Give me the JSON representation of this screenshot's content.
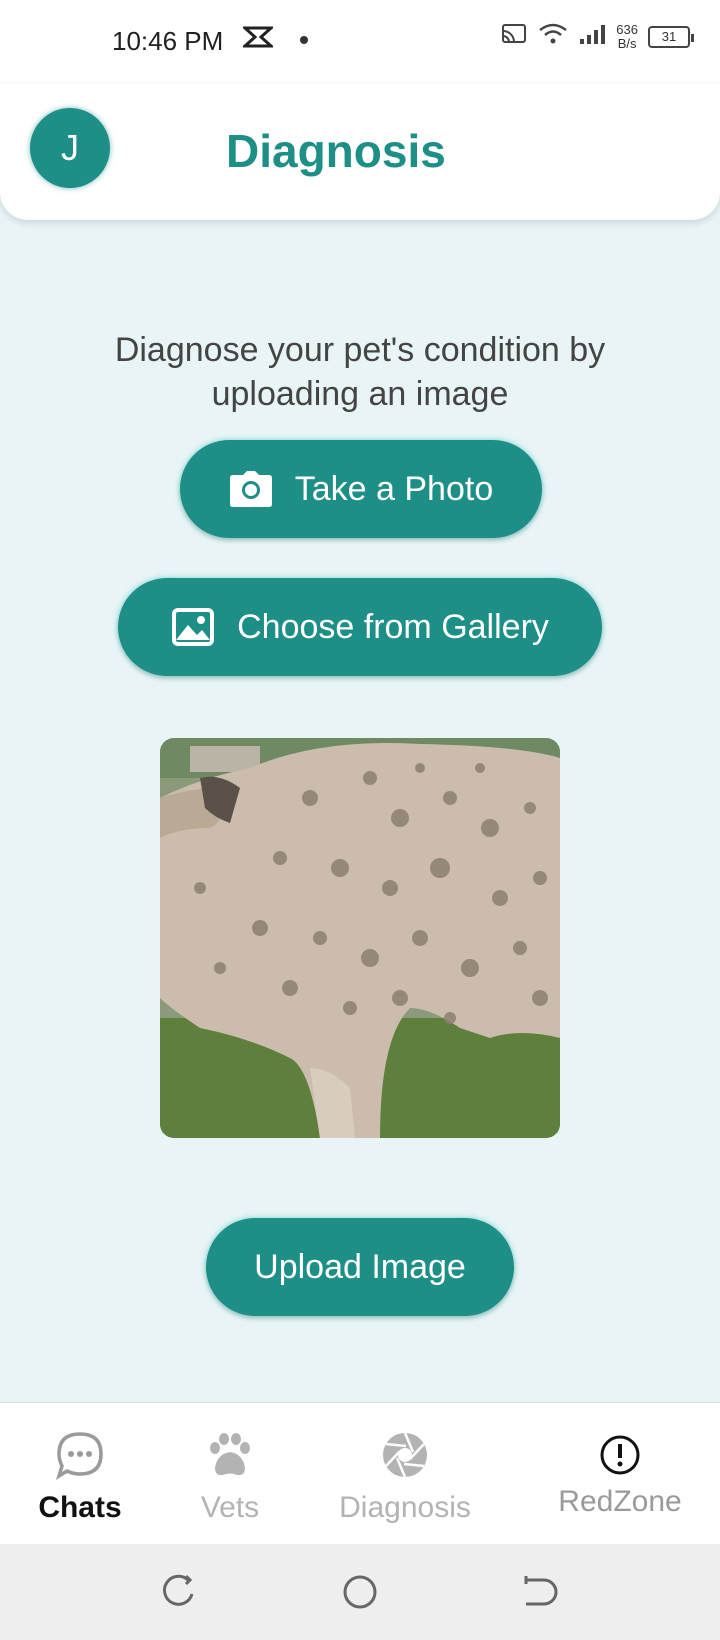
{
  "status_bar": {
    "time": "10:46 PM",
    "net_speed_value": "636",
    "net_speed_unit": "B/s",
    "battery": "31"
  },
  "header": {
    "avatar_initial": "J",
    "title": "Diagnosis"
  },
  "main": {
    "instruction": "Diagnose your pet's condition by uploading an image",
    "take_photo_label": "Take a Photo",
    "gallery_label": "Choose from Gallery",
    "upload_label": "Upload Image"
  },
  "bottom_nav": {
    "items": [
      {
        "label": "Chats",
        "icon": "chat-bubble-icon",
        "active": true
      },
      {
        "label": "Vets",
        "icon": "paw-icon",
        "active": false
      },
      {
        "label": "Diagnosis",
        "icon": "aperture-icon",
        "active": false
      },
      {
        "label": "RedZone",
        "icon": "alert-circle-icon",
        "active": false
      }
    ]
  },
  "colors": {
    "accent": "#1e8f86",
    "background": "#e8f4f6"
  }
}
